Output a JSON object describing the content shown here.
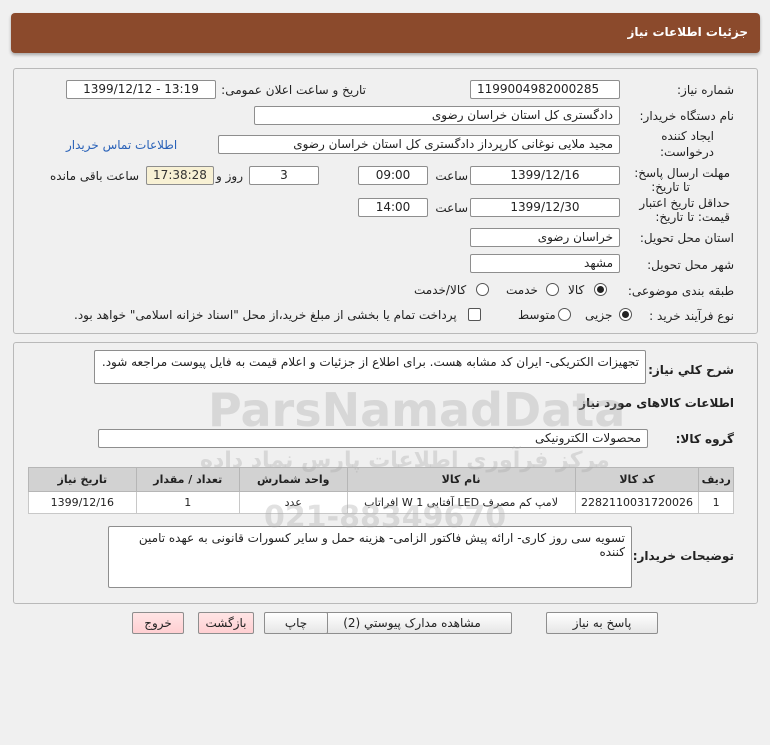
{
  "header": {
    "title": "جزئیات اطلاعات نیاز"
  },
  "info": {
    "need_number_label": "شماره نیاز:",
    "need_number": "1199004982000285",
    "announce_label": "تاریخ و ساعت اعلان عمومی:",
    "announce_value": "1399/12/12 - 13:19",
    "buyer_label": "نام دستگاه خریدار:",
    "buyer_value": "دادگستری کل استان خراسان رضوی",
    "creator_label_1": "ایجاد کننده",
    "creator_label_2": "درخواست:",
    "creator_value": "مجید ملایی نوغانی کارپرداز دادگستری کل استان خراسان رضوی",
    "contact_link": "اطلاعات تماس خریدار",
    "deadline_label_1": "مهلت ارسال پاسخ:",
    "deadline_label_2": "تا تاریخ:",
    "deadline_date": "1399/12/16",
    "time_label": "ساعت",
    "deadline_time": "09:00",
    "days_value": "3",
    "days_label": "روز و",
    "remaining_value": "17:38:28",
    "remaining_label": "ساعت باقی مانده",
    "validity_label_1": "حداقل تاریخ اعتبار",
    "validity_label_2": "قیمت: تا تاریخ:",
    "validity_date": "1399/12/30",
    "validity_time": "14:00",
    "province_label": "استان محل تحویل:",
    "province_value": "خراسان رضوی",
    "city_label": "شهر محل تحویل:",
    "city_value": "مشهد",
    "category_label": "طبقه بندی موضوعی:",
    "category_options": [
      "کالا",
      "خدمت",
      "کالا/خدمت"
    ],
    "category_selected": "کالا",
    "process_label": "نوع فرآیند خرید :",
    "process_options": [
      "جزیی",
      "متوسط"
    ],
    "process_selected": "جزیی",
    "payment_note": "پرداخت تمام یا بخشی از مبلغ خرید،از محل \"اسناد خزانه اسلامی\" خواهد بود."
  },
  "description": {
    "label": "شرح کلي نياز:",
    "text": "تجهیزات الکتریکی- ایران کد مشابه هست. برای اطلاع از جزئیات و اعلام قیمت به فایل پیوست مراجعه شود."
  },
  "goods": {
    "section_title": "اطلاعات کالاهای مورد نیاز",
    "group_label": "گروه کالا:",
    "group_value": "محصولات الکترونیکی",
    "columns": [
      "ردیف",
      "کد کالا",
      "نام کالا",
      "واحد شمارش",
      "تعداد / مقدار",
      "تاریخ نیاز"
    ],
    "rows": [
      [
        "1",
        "2282110031720026",
        "لامپ کم مصرف LED آفتابی 1 W افراتاب",
        "عدد",
        "1",
        "1399/12/16"
      ]
    ]
  },
  "buyer_notes": {
    "label": "توضیحات خریدار:",
    "text": "تسویه سی روز کاری- ارائه پیش فاکتور الزامی- هزینه حمل و سایر کسورات قانونی به عهده تامین کننده"
  },
  "buttons": {
    "reply": "پاسخ به نیاز",
    "attachments": "مشاهده مدارک پیوستي (2)",
    "print": "چاپ",
    "back": "بازگشت",
    "exit": "خروج"
  },
  "colors": {
    "header_bg": "#8b4a2c",
    "link": "#2a62b8",
    "remaining_bg": "#f8f1d4",
    "pink_button": "#ffcfd2"
  },
  "watermark": {
    "brand": "ParsNamadData",
    "line_fa": "مرکز فرآوری اطلاعات پارس نماد داده",
    "phone": "021-88349670"
  }
}
